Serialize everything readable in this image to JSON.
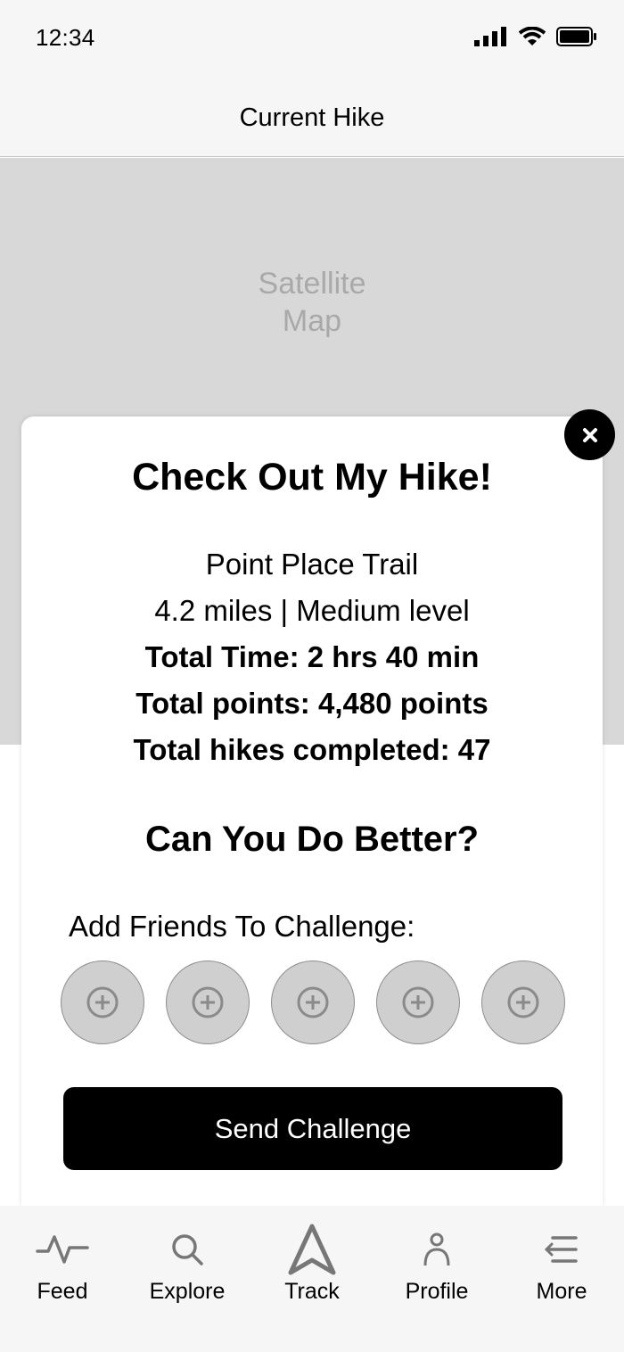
{
  "status_bar": {
    "time": "12:34"
  },
  "header": {
    "title": "Current Hike"
  },
  "map": {
    "label_line1": "Satellite",
    "label_line2": "Map"
  },
  "card": {
    "title": "Check Out My Hike!",
    "trail_name": "Point Place Trail",
    "trail_info": "4.2 miles | Medium level",
    "total_time": "Total Time: 2 hrs 40 min",
    "total_points": "Total points: 4,480 points",
    "total_hikes": "Total hikes completed: 47",
    "challenge_title": "Can You Do Better?",
    "friends_label": "Add Friends To Challenge:",
    "friend_slots": [
      "add-friend-1",
      "add-friend-2",
      "add-friend-3",
      "add-friend-4",
      "add-friend-5"
    ],
    "send_label": "Send Challenge"
  },
  "tabs": [
    {
      "label": "Feed",
      "icon": "activity-icon"
    },
    {
      "label": "Explore",
      "icon": "search-icon"
    },
    {
      "label": "Track",
      "icon": "navigation-arrow-icon"
    },
    {
      "label": "Profile",
      "icon": "person-icon"
    },
    {
      "label": "More",
      "icon": "menu-icon"
    }
  ],
  "colors": {
    "map_bg": "#d8d8d8",
    "bar_bg": "#f6f6f6",
    "button_bg": "#000000",
    "slot_bg": "#cfcfcf"
  }
}
